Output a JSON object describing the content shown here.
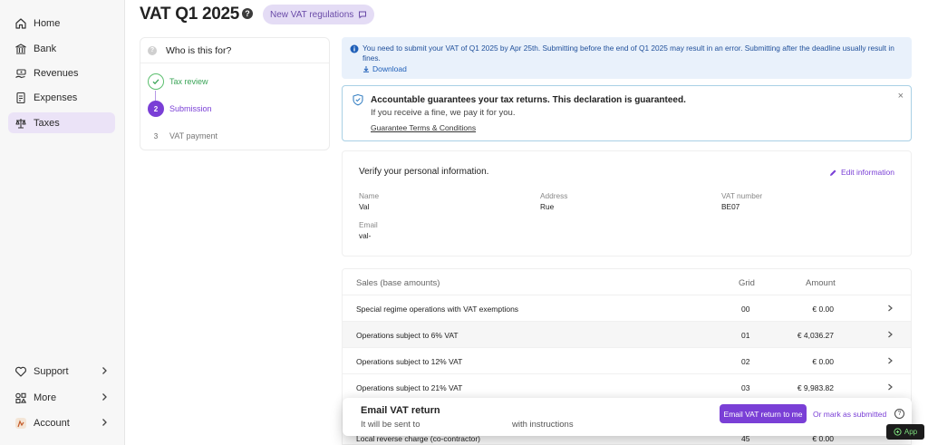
{
  "sidebar": {
    "items": [
      {
        "label": "Home"
      },
      {
        "label": "Bank"
      },
      {
        "label": "Revenues"
      },
      {
        "label": "Expenses"
      },
      {
        "label": "Taxes"
      }
    ],
    "bottom": [
      {
        "label": "Support"
      },
      {
        "label": "More"
      },
      {
        "label": "Account"
      }
    ]
  },
  "header": {
    "title": "VAT Q1 2025",
    "help": "?",
    "badge": "New VAT regulations"
  },
  "stepper": {
    "question": "Who is this for?",
    "steps": [
      {
        "num": "✓",
        "label": "Tax review",
        "state": "done"
      },
      {
        "num": "2",
        "label": "Submission",
        "state": "active"
      },
      {
        "num": "3",
        "label": "VAT payment",
        "state": "pending"
      }
    ]
  },
  "info": {
    "text": "You need to submit your VAT of Q1 2025 by Apr 25th. Submitting before the end of Q1 2025 may result in an error. Submitting after the deadline usually result in fines.",
    "download": "Download"
  },
  "guarantee": {
    "title": "Accountable guarantees your tax returns. This declaration is guaranteed.",
    "subtitle": "If you receive a fine, we pay it for you.",
    "link": "Guarantee Terms & Conditions",
    "close": "×"
  },
  "personal": {
    "heading": "Verify your personal information.",
    "edit": "Edit information",
    "name_label": "Name",
    "name_value": "Val",
    "address_label": "Address",
    "address_value": "Rue",
    "vat_label": "VAT number",
    "vat_value": "BE07",
    "email_label": "Email",
    "email_value": "val-"
  },
  "sales": {
    "col1": "Sales (base amounts)",
    "col2": "Grid",
    "col3": "Amount",
    "rows": [
      {
        "label": "Special regime operations with VAT exemptions",
        "grid": "00",
        "amount": "€ 0.00"
      },
      {
        "label": "Operations subject to 6% VAT",
        "grid": "01",
        "amount": "€ 4,036.27"
      },
      {
        "label": "Operations subject to 12% VAT",
        "grid": "02",
        "amount": "€ 0.00"
      },
      {
        "label": "Operations subject to 21% VAT",
        "grid": "03",
        "amount": "€ 9,983.82"
      },
      {
        "label": "Local reverse charge (co-contractor)",
        "grid": "45",
        "amount": "€ 0.00"
      }
    ]
  },
  "bottom_bar": {
    "title": "Email VAT return",
    "sent_to": "It will be sent to",
    "instructions": "with instructions",
    "button": "Email VAT return to me",
    "mark": "Or mark as submitted",
    "help": "?"
  },
  "app_button": "App",
  "colors": {
    "accent": "#7a3fd6",
    "success": "#3aa457",
    "info": "#1f4f9a"
  }
}
